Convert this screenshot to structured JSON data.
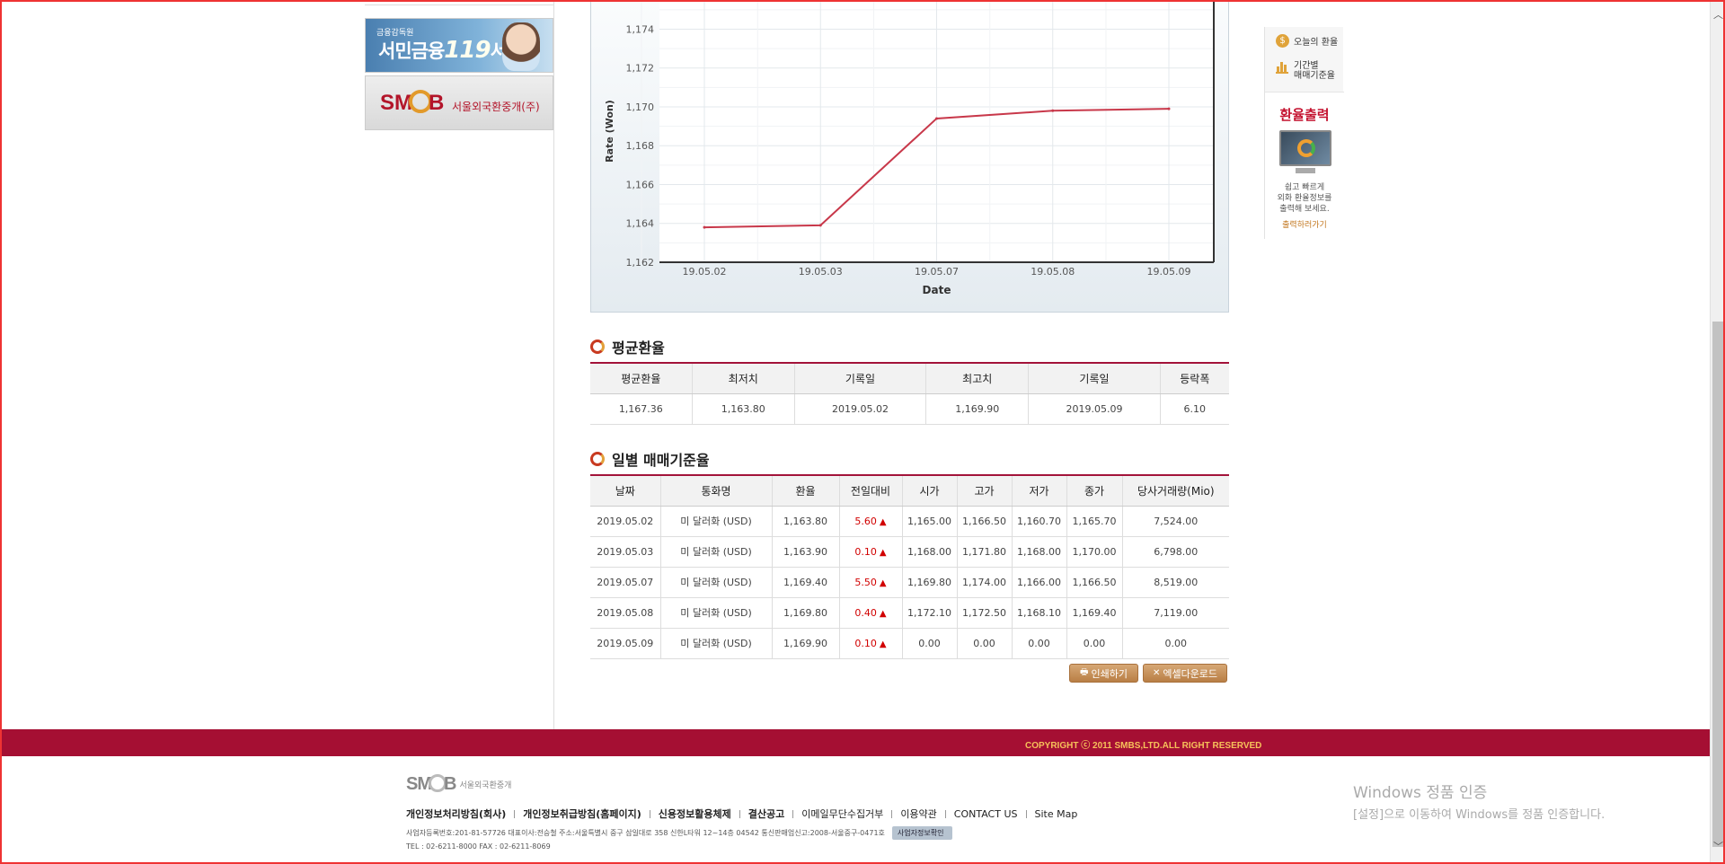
{
  "sidebar": {
    "banner_119": {
      "small": "금융감독원",
      "title": "서민금융",
      "number": "119",
      "suffix": "서비스"
    },
    "banner_smb": {
      "logo": "SMB",
      "text": "서울외국환중개(주)"
    }
  },
  "chart_data": {
    "type": "line",
    "title": "",
    "xlabel": "Date",
    "ylabel": "Rate (Won)",
    "x": [
      "19.05.02",
      "19.05.03",
      "19.05.07",
      "19.05.08",
      "19.05.09"
    ],
    "series": [
      {
        "values": [
          1163.8,
          1163.9,
          1169.4,
          1169.8,
          1169.9
        ]
      }
    ],
    "y_ticks": [
      "1,162",
      "1,164",
      "1,166",
      "1,168",
      "1,170",
      "1,172",
      "1,174"
    ],
    "ylim": [
      1162,
      1175.5
    ],
    "grid": true,
    "line_color": "#c8384a"
  },
  "avg": {
    "title": "평균환율",
    "headers": [
      "평균환율",
      "최저치",
      "기록일",
      "최고치",
      "기록일",
      "등락폭"
    ],
    "row": [
      "1,167.36",
      "1,163.80",
      "2019.05.02",
      "1,169.90",
      "2019.05.09",
      "6.10"
    ]
  },
  "daily": {
    "title": "일별 매매기준율",
    "headers": [
      "날짜",
      "통화명",
      "환율",
      "전일대비",
      "시가",
      "고가",
      "저가",
      "종가",
      "당사거래량(Mio)"
    ],
    "rows": [
      [
        "2019.05.02",
        "미 달러화 (USD)",
        "1,163.80",
        "5.60",
        "1,165.00",
        "1,166.50",
        "1,160.70",
        "1,165.70",
        "7,524.00"
      ],
      [
        "2019.05.03",
        "미 달러화 (USD)",
        "1,163.90",
        "0.10",
        "1,168.00",
        "1,171.80",
        "1,168.00",
        "1,170.00",
        "6,798.00"
      ],
      [
        "2019.05.07",
        "미 달러화 (USD)",
        "1,169.40",
        "5.50",
        "1,169.80",
        "1,174.00",
        "1,166.00",
        "1,166.50",
        "8,519.00"
      ],
      [
        "2019.05.08",
        "미 달러화 (USD)",
        "1,169.80",
        "0.40",
        "1,172.10",
        "1,172.50",
        "1,168.10",
        "1,169.40",
        "7,119.00"
      ],
      [
        "2019.05.09",
        "미 달러화 (USD)",
        "1,169.90",
        "0.10",
        "0.00",
        "0.00",
        "0.00",
        "0.00",
        "0.00"
      ]
    ],
    "up_arrow": "▲"
  },
  "buttons": {
    "print": "인쇄하기",
    "excel": "엑셀다운로드"
  },
  "quick_menu": {
    "today_rate": "오늘의 환율",
    "period_line1": "기간별",
    "period_line2": "매매기준율",
    "print_title": "환율출력",
    "print_desc1": "쉽고 빠르게",
    "print_desc2": "외화 환율정보를",
    "print_desc3": "출력해 보세요.",
    "print_link": "출력하러가기"
  },
  "footer": {
    "copyright": "COPYRIGHT ⓒ 2011 SMBS,LTD.ALL RIGHT RESERVED",
    "logo": "SMB",
    "logo_caption": "서울외국환중개",
    "links": [
      "개인정보처리방침(회사)",
      "개인정보취급방침(홈페이지)",
      "신용정보활용체제",
      "결산공고",
      "이메일무단수집거부",
      "이용약관",
      "CONTACT US",
      "Site Map"
    ],
    "address": "사업자등록번호:201-81-57726   대표이사:전승철   주소:서울특별시 중구 삼일대로 358 신한L타워 12~14층 04542   통신판매업신고:2008-서울중구-0471호",
    "biz_check": "사업자정보확인",
    "tel": "TEL : 02-6211-8000   FAX : 02-6211-8069"
  },
  "watermark": {
    "line1": "Windows 정품 인증",
    "line2": "[설정]으로 이동하여 Windows를 정품 인증합니다."
  }
}
